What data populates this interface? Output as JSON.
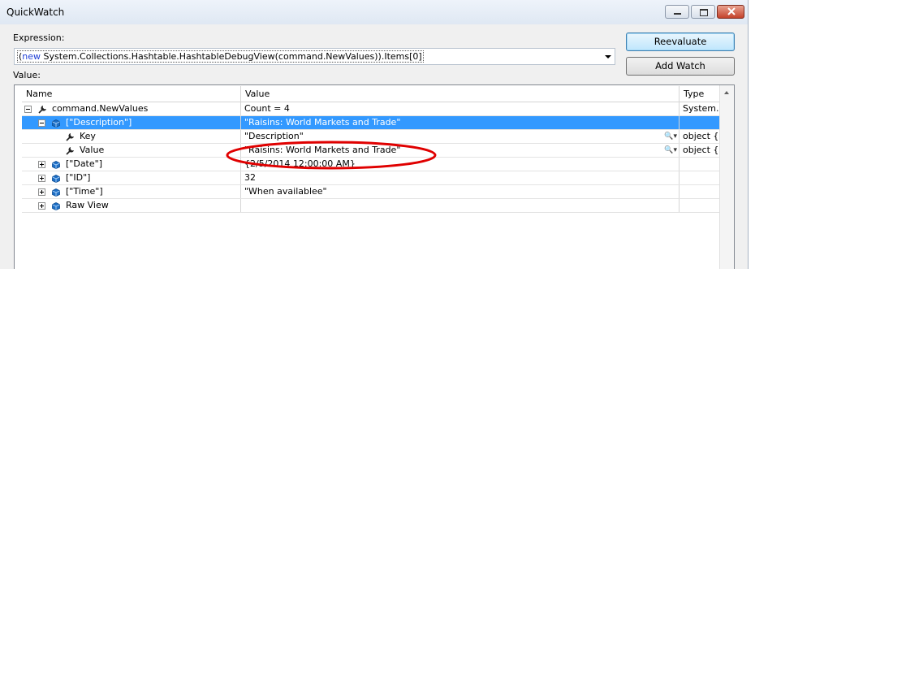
{
  "window": {
    "title": "QuickWatch"
  },
  "expression": {
    "label": "Expression:",
    "keyword": "new",
    "prefix": "(",
    "rest": " System.Collections.Hashtable.HashtableDebugView(command.NewValues)).Items[0]"
  },
  "value_label": "Value:",
  "buttons": {
    "reevaluate": "Reevaluate",
    "add_watch": "Add Watch"
  },
  "columns": {
    "name": "Name",
    "value": "Value",
    "type": "Type"
  },
  "rows": [
    {
      "name": "command.NewValues",
      "value": "Count = 4",
      "type": "System.C",
      "icon": "wrench-icon",
      "expander": "minus",
      "level": 0,
      "selected": false
    },
    {
      "name": "[\"Description\"]",
      "value": "\"Raisins: World Markets and Trade\"",
      "type": "",
      "icon": "field-icon",
      "expander": "minus",
      "level": 1,
      "selected": true
    },
    {
      "name": "Key",
      "value": "\"Description\"",
      "type": "object {s",
      "icon": "wrench-icon",
      "expander": "none",
      "level": 2,
      "selected": false,
      "magnifier": true
    },
    {
      "name": "Value",
      "value": "\"Raisins: World Markets and Trade\"",
      "type": "object {s",
      "icon": "wrench-icon",
      "expander": "none",
      "level": 2,
      "selected": false,
      "magnifier": true
    },
    {
      "name": "[\"Date\"]",
      "value": "{2/5/2014 12:00:00 AM}",
      "type": "",
      "icon": "field-icon",
      "expander": "plus",
      "level": 1,
      "selected": false
    },
    {
      "name": "[\"ID\"]",
      "value": "32",
      "type": "",
      "icon": "field-icon",
      "expander": "plus",
      "level": 1,
      "selected": false
    },
    {
      "name": "[\"Time\"]",
      "value": "\"When availablee\"",
      "type": "",
      "icon": "field-icon",
      "expander": "plus",
      "level": 1,
      "selected": false
    },
    {
      "name": "Raw View",
      "value": "",
      "type": "",
      "icon": "field-icon",
      "expander": "plus",
      "level": 1,
      "selected": false
    }
  ],
  "colors": {
    "selection": "#3399ff",
    "annotation": "#e00000",
    "keyword": "#1f3fd6"
  }
}
